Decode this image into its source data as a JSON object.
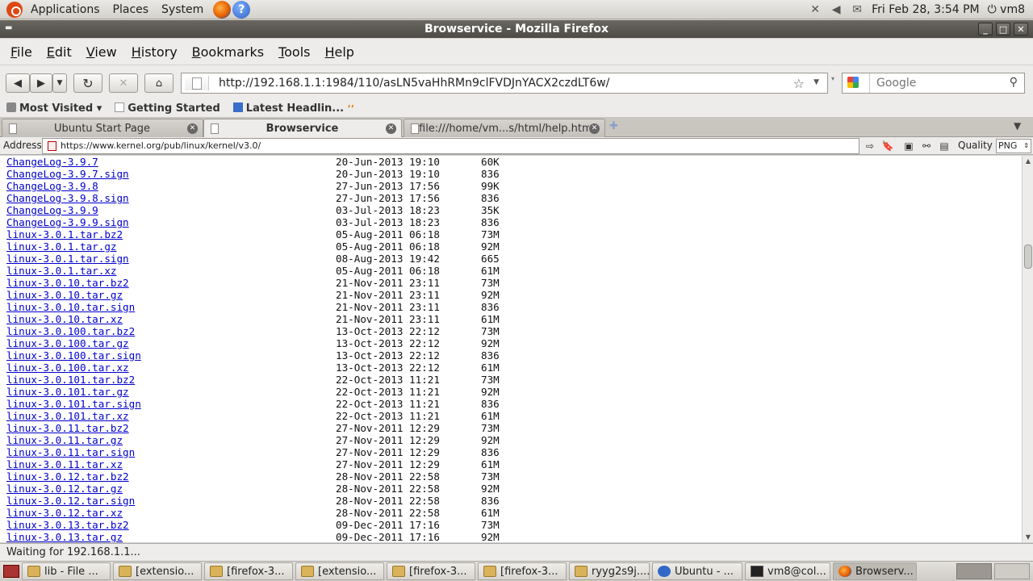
{
  "panel": {
    "menus": [
      "Applications",
      "Places",
      "System"
    ],
    "clock": "Fri Feb 28,  3:54 PM",
    "user": "vm8"
  },
  "window": {
    "title": "Browservice - Mozilla Firefox"
  },
  "menubar": [
    "File",
    "Edit",
    "View",
    "History",
    "Bookmarks",
    "Tools",
    "Help"
  ],
  "nav": {
    "url": "http://192.168.1.1:1984/110/asLN5vaHhRMn9clFVDJnYACX2czdLT6w/",
    "search_placeholder": "Google"
  },
  "bookmarks": [
    "Most Visited",
    "Getting Started",
    "Latest Headlin..."
  ],
  "tabs": [
    {
      "label": "Ubuntu Start Page",
      "active": false
    },
    {
      "label": "Browservice",
      "active": true
    },
    {
      "label": "file:///home/vm...s/html/help.htm",
      "active": false
    }
  ],
  "inner": {
    "address_label": "Address",
    "address_value": "https://www.kernel.org/pub/linux/kernel/v3.0/",
    "quality_label": "Quality",
    "format": "PNG"
  },
  "listing": [
    [
      "ChangeLog-3.9.7",
      "20-Jun-2013 19:10",
      "60K"
    ],
    [
      "ChangeLog-3.9.7.sign",
      "20-Jun-2013 19:10",
      "836"
    ],
    [
      "ChangeLog-3.9.8",
      "27-Jun-2013 17:56",
      "99K"
    ],
    [
      "ChangeLog-3.9.8.sign",
      "27-Jun-2013 17:56",
      "836"
    ],
    [
      "ChangeLog-3.9.9",
      "03-Jul-2013 18:23",
      "35K"
    ],
    [
      "ChangeLog-3.9.9.sign",
      "03-Jul-2013 18:23",
      "836"
    ],
    [
      "linux-3.0.1.tar.bz2",
      "05-Aug-2011 06:18",
      "73M"
    ],
    [
      "linux-3.0.1.tar.gz",
      "05-Aug-2011 06:18",
      "92M"
    ],
    [
      "linux-3.0.1.tar.sign",
      "08-Aug-2013 19:42",
      "665"
    ],
    [
      "linux-3.0.1.tar.xz",
      "05-Aug-2011 06:18",
      "61M"
    ],
    [
      "linux-3.0.10.tar.bz2",
      "21-Nov-2011 23:11",
      "73M"
    ],
    [
      "linux-3.0.10.tar.gz",
      "21-Nov-2011 23:11",
      "92M"
    ],
    [
      "linux-3.0.10.tar.sign",
      "21-Nov-2011 23:11",
      "836"
    ],
    [
      "linux-3.0.10.tar.xz",
      "21-Nov-2011 23:11",
      "61M"
    ],
    [
      "linux-3.0.100.tar.bz2",
      "13-Oct-2013 22:12",
      "73M"
    ],
    [
      "linux-3.0.100.tar.gz",
      "13-Oct-2013 22:12",
      "92M"
    ],
    [
      "linux-3.0.100.tar.sign",
      "13-Oct-2013 22:12",
      "836"
    ],
    [
      "linux-3.0.100.tar.xz",
      "13-Oct-2013 22:12",
      "61M"
    ],
    [
      "linux-3.0.101.tar.bz2",
      "22-Oct-2013 11:21",
      "73M"
    ],
    [
      "linux-3.0.101.tar.gz",
      "22-Oct-2013 11:21",
      "92M"
    ],
    [
      "linux-3.0.101.tar.sign",
      "22-Oct-2013 11:21",
      "836"
    ],
    [
      "linux-3.0.101.tar.xz",
      "22-Oct-2013 11:21",
      "61M"
    ],
    [
      "linux-3.0.11.tar.bz2",
      "27-Nov-2011 12:29",
      "73M"
    ],
    [
      "linux-3.0.11.tar.gz",
      "27-Nov-2011 12:29",
      "92M"
    ],
    [
      "linux-3.0.11.tar.sign",
      "27-Nov-2011 12:29",
      "836"
    ],
    [
      "linux-3.0.11.tar.xz",
      "27-Nov-2011 12:29",
      "61M"
    ],
    [
      "linux-3.0.12.tar.bz2",
      "28-Nov-2011 22:58",
      "73M"
    ],
    [
      "linux-3.0.12.tar.gz",
      "28-Nov-2011 22:58",
      "92M"
    ],
    [
      "linux-3.0.12.tar.sign",
      "28-Nov-2011 22:58",
      "836"
    ],
    [
      "linux-3.0.12.tar.xz",
      "28-Nov-2011 22:58",
      "61M"
    ],
    [
      "linux-3.0.13.tar.bz2",
      "09-Dec-2011 17:16",
      "73M"
    ],
    [
      "linux-3.0.13.tar.gz",
      "09-Dec-2011 17:16",
      "92M"
    ]
  ],
  "status": "Waiting for 192.168.1.1...",
  "taskbar": [
    {
      "label": "lib - File ...",
      "icon": "folder"
    },
    {
      "label": "[extensio...",
      "icon": "folder"
    },
    {
      "label": "[firefox-3...",
      "icon": "folder"
    },
    {
      "label": "[extensio...",
      "icon": "folder"
    },
    {
      "label": "[firefox-3...",
      "icon": "folder"
    },
    {
      "label": "[firefox-3...",
      "icon": "folder"
    },
    {
      "label": "ryyg2s9j....",
      "icon": "folder"
    },
    {
      "label": "Ubuntu - ...",
      "icon": "help"
    },
    {
      "label": "vm8@col...",
      "icon": "term"
    },
    {
      "label": "Browserv...",
      "icon": "ff",
      "active": true
    }
  ]
}
